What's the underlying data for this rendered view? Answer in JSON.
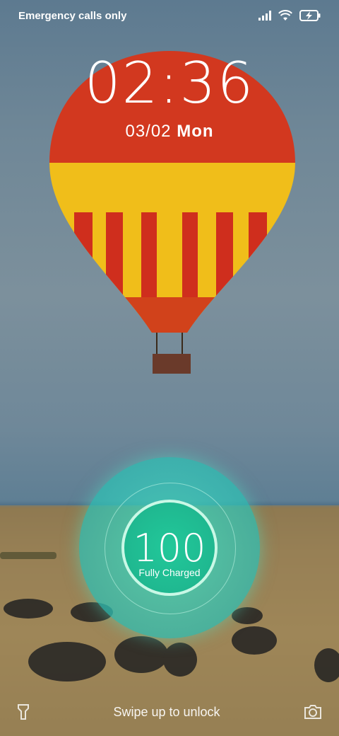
{
  "status_bar": {
    "carrier_text": "Emergency calls only",
    "icons": [
      "signal-icon",
      "wifi-icon",
      "battery-charging-icon"
    ]
  },
  "clock": {
    "time": "02:36",
    "date": "03/02",
    "day": "Mon"
  },
  "charging": {
    "level": "100",
    "status": "Fully Charged",
    "accent_color": "#2fd1a8"
  },
  "bottom": {
    "hint": "Swipe up to unlock",
    "left_icon": "flashlight-icon",
    "right_icon": "camera-icon"
  }
}
